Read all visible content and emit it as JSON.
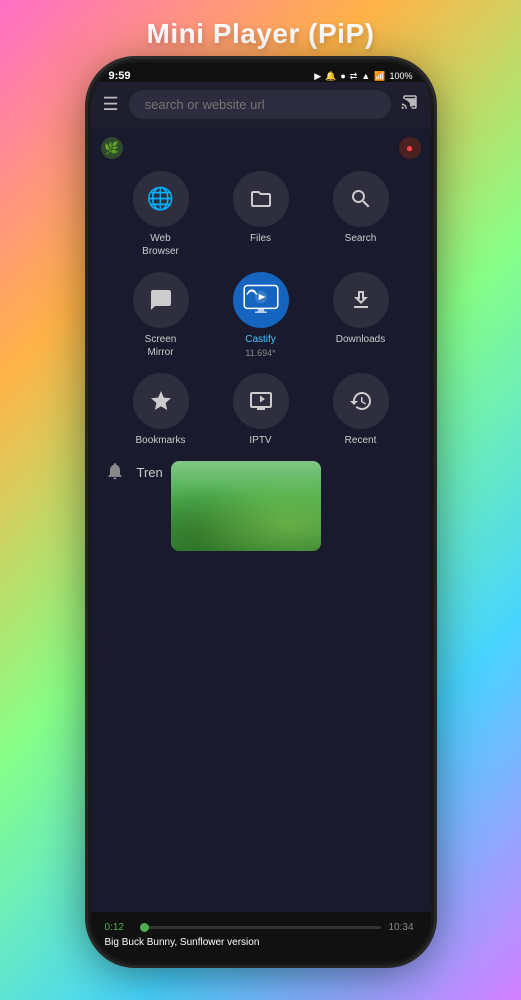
{
  "header": {
    "title": "Mini Player (PiP)"
  },
  "status_bar": {
    "time": "9:59",
    "battery": "100%",
    "icons": [
      "yt",
      "bell",
      "dot",
      "wifi",
      "signal",
      "battery"
    ]
  },
  "search_bar": {
    "placeholder": "search or website url"
  },
  "indicators": {
    "left_icon": "🌿",
    "right_icon": "🔴"
  },
  "apps": [
    {
      "id": "web-browser",
      "label": "Web\nBrowser",
      "icon": "🌐",
      "type": "normal"
    },
    {
      "id": "files",
      "label": "Files",
      "icon": "💾",
      "type": "normal"
    },
    {
      "id": "search",
      "label": "Search",
      "icon": "🔍",
      "type": "normal"
    },
    {
      "id": "screen-mirror",
      "label": "Screen\nMirror",
      "icon": "📺",
      "type": "normal"
    },
    {
      "id": "castify",
      "label": "Castify",
      "sublabel": "11.694*",
      "icon": "castify",
      "type": "castify"
    },
    {
      "id": "downloads",
      "label": "Downloads",
      "icon": "⬇",
      "type": "normal"
    },
    {
      "id": "bookmarks",
      "label": "Bookmarks",
      "icon": "⭐",
      "type": "normal"
    },
    {
      "id": "iptv",
      "label": "IPTV",
      "icon": "📺",
      "type": "normal"
    },
    {
      "id": "recent",
      "label": "Recent",
      "icon": "🕐",
      "type": "normal"
    }
  ],
  "trend_section": {
    "label": "Tren"
  },
  "mini_player": {
    "title": "Big Buck Bunny, Sunflower version",
    "current_time": "0:12",
    "total_time": "10:34",
    "progress_percent": 2
  }
}
